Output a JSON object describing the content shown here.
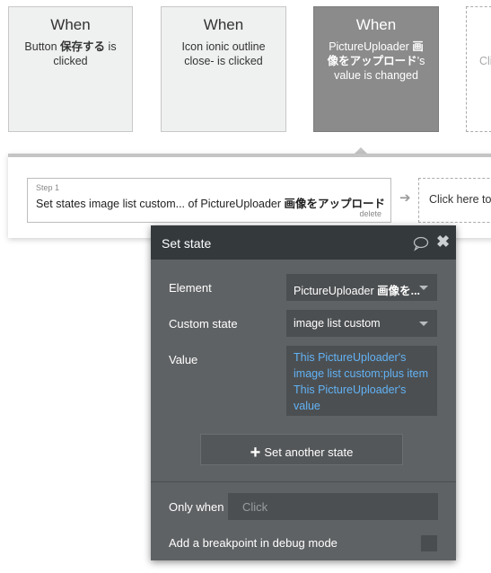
{
  "events": [
    {
      "title": "When",
      "desc_pre": "Button ",
      "desc_bold": "保存する",
      "desc_post": " is clicked"
    },
    {
      "title": "When",
      "desc": "Icon ionic outline close- is clicked"
    },
    {
      "title": "When",
      "desc_pre": "PictureUploader ",
      "desc_bold": "画像をアップロード",
      "desc_post": "'s value is changed"
    },
    {
      "title": "",
      "desc": "Cli"
    }
  ],
  "step": {
    "label": "Step 1",
    "text_pre": "Set states image list custom... of PictureUploader ",
    "text_bold": "画像をアップロード",
    "delete": "delete"
  },
  "add_step": "Click here to",
  "popup": {
    "title": "Set state",
    "element_label": "Element",
    "element_value_pre": "PictureUploader ",
    "element_value_bold": "画像を...",
    "custom_state_label": "Custom state",
    "custom_state_value": "image list custom",
    "value_label": "Value",
    "value_expr": "This PictureUploader's image list custom:plus item This PictureUploader's value",
    "set_another": "Set another state",
    "only_when_label": "Only when",
    "only_when_placeholder": "Click",
    "breakpoint_label": "Add a breakpoint in debug mode"
  },
  "colors": {
    "expression": "#62b2f5",
    "popup_bg": "#5f6264",
    "popup_header": "#34393c"
  }
}
